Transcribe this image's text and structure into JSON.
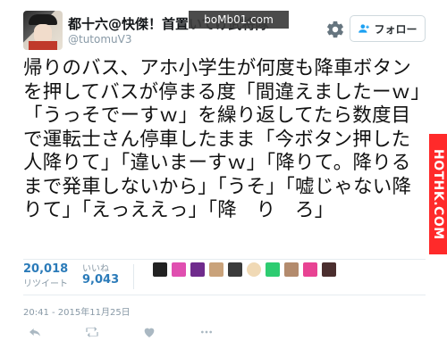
{
  "header": {
    "display_name": "都十六@快傑！首置いてけ武将隊",
    "handle": "@tutomuV3",
    "follow_label": "フォロー",
    "gear_icon": "gear-icon",
    "follow_icon": "person-add-icon"
  },
  "watermark": {
    "text": "boMb01.com"
  },
  "side_watermark": {
    "text": "HOTHK.COM"
  },
  "tweet": {
    "text": "帰りのバス、アホ小学生が何度も降車ボタンを押してバスが停まる度「間違えましたーｗ」「うっそでーすｗ」を繰り返してたら数度目で運転士さん停車したまま「今ボタン押した人降りて」「違いまーすｗ」「降りて。降りるまで発車しないから」「うそ」「嘘じゃない降りて」「えっええっ」「降　り　ろ」"
  },
  "stats": {
    "retweets": "20,018",
    "retweets_label": "リツイート",
    "likes": "9,043",
    "likes_label": "いいね"
  },
  "liker_avatars": [
    "avatar-1",
    "avatar-2",
    "avatar-3",
    "avatar-4",
    "avatar-5",
    "avatar-6",
    "avatar-7",
    "avatar-8",
    "avatar-9",
    "avatar-10"
  ],
  "timestamp": "20:41 - 2015年11月25日",
  "actions": {
    "reply_icon": "reply-icon",
    "retweet_icon": "retweet-icon",
    "like_icon": "heart-icon",
    "more_icon": "more-icon"
  },
  "colors": {
    "link_blue": "#2b7bb9",
    "muted_gray": "#8899a6",
    "side_red": "#ff2a2a"
  }
}
